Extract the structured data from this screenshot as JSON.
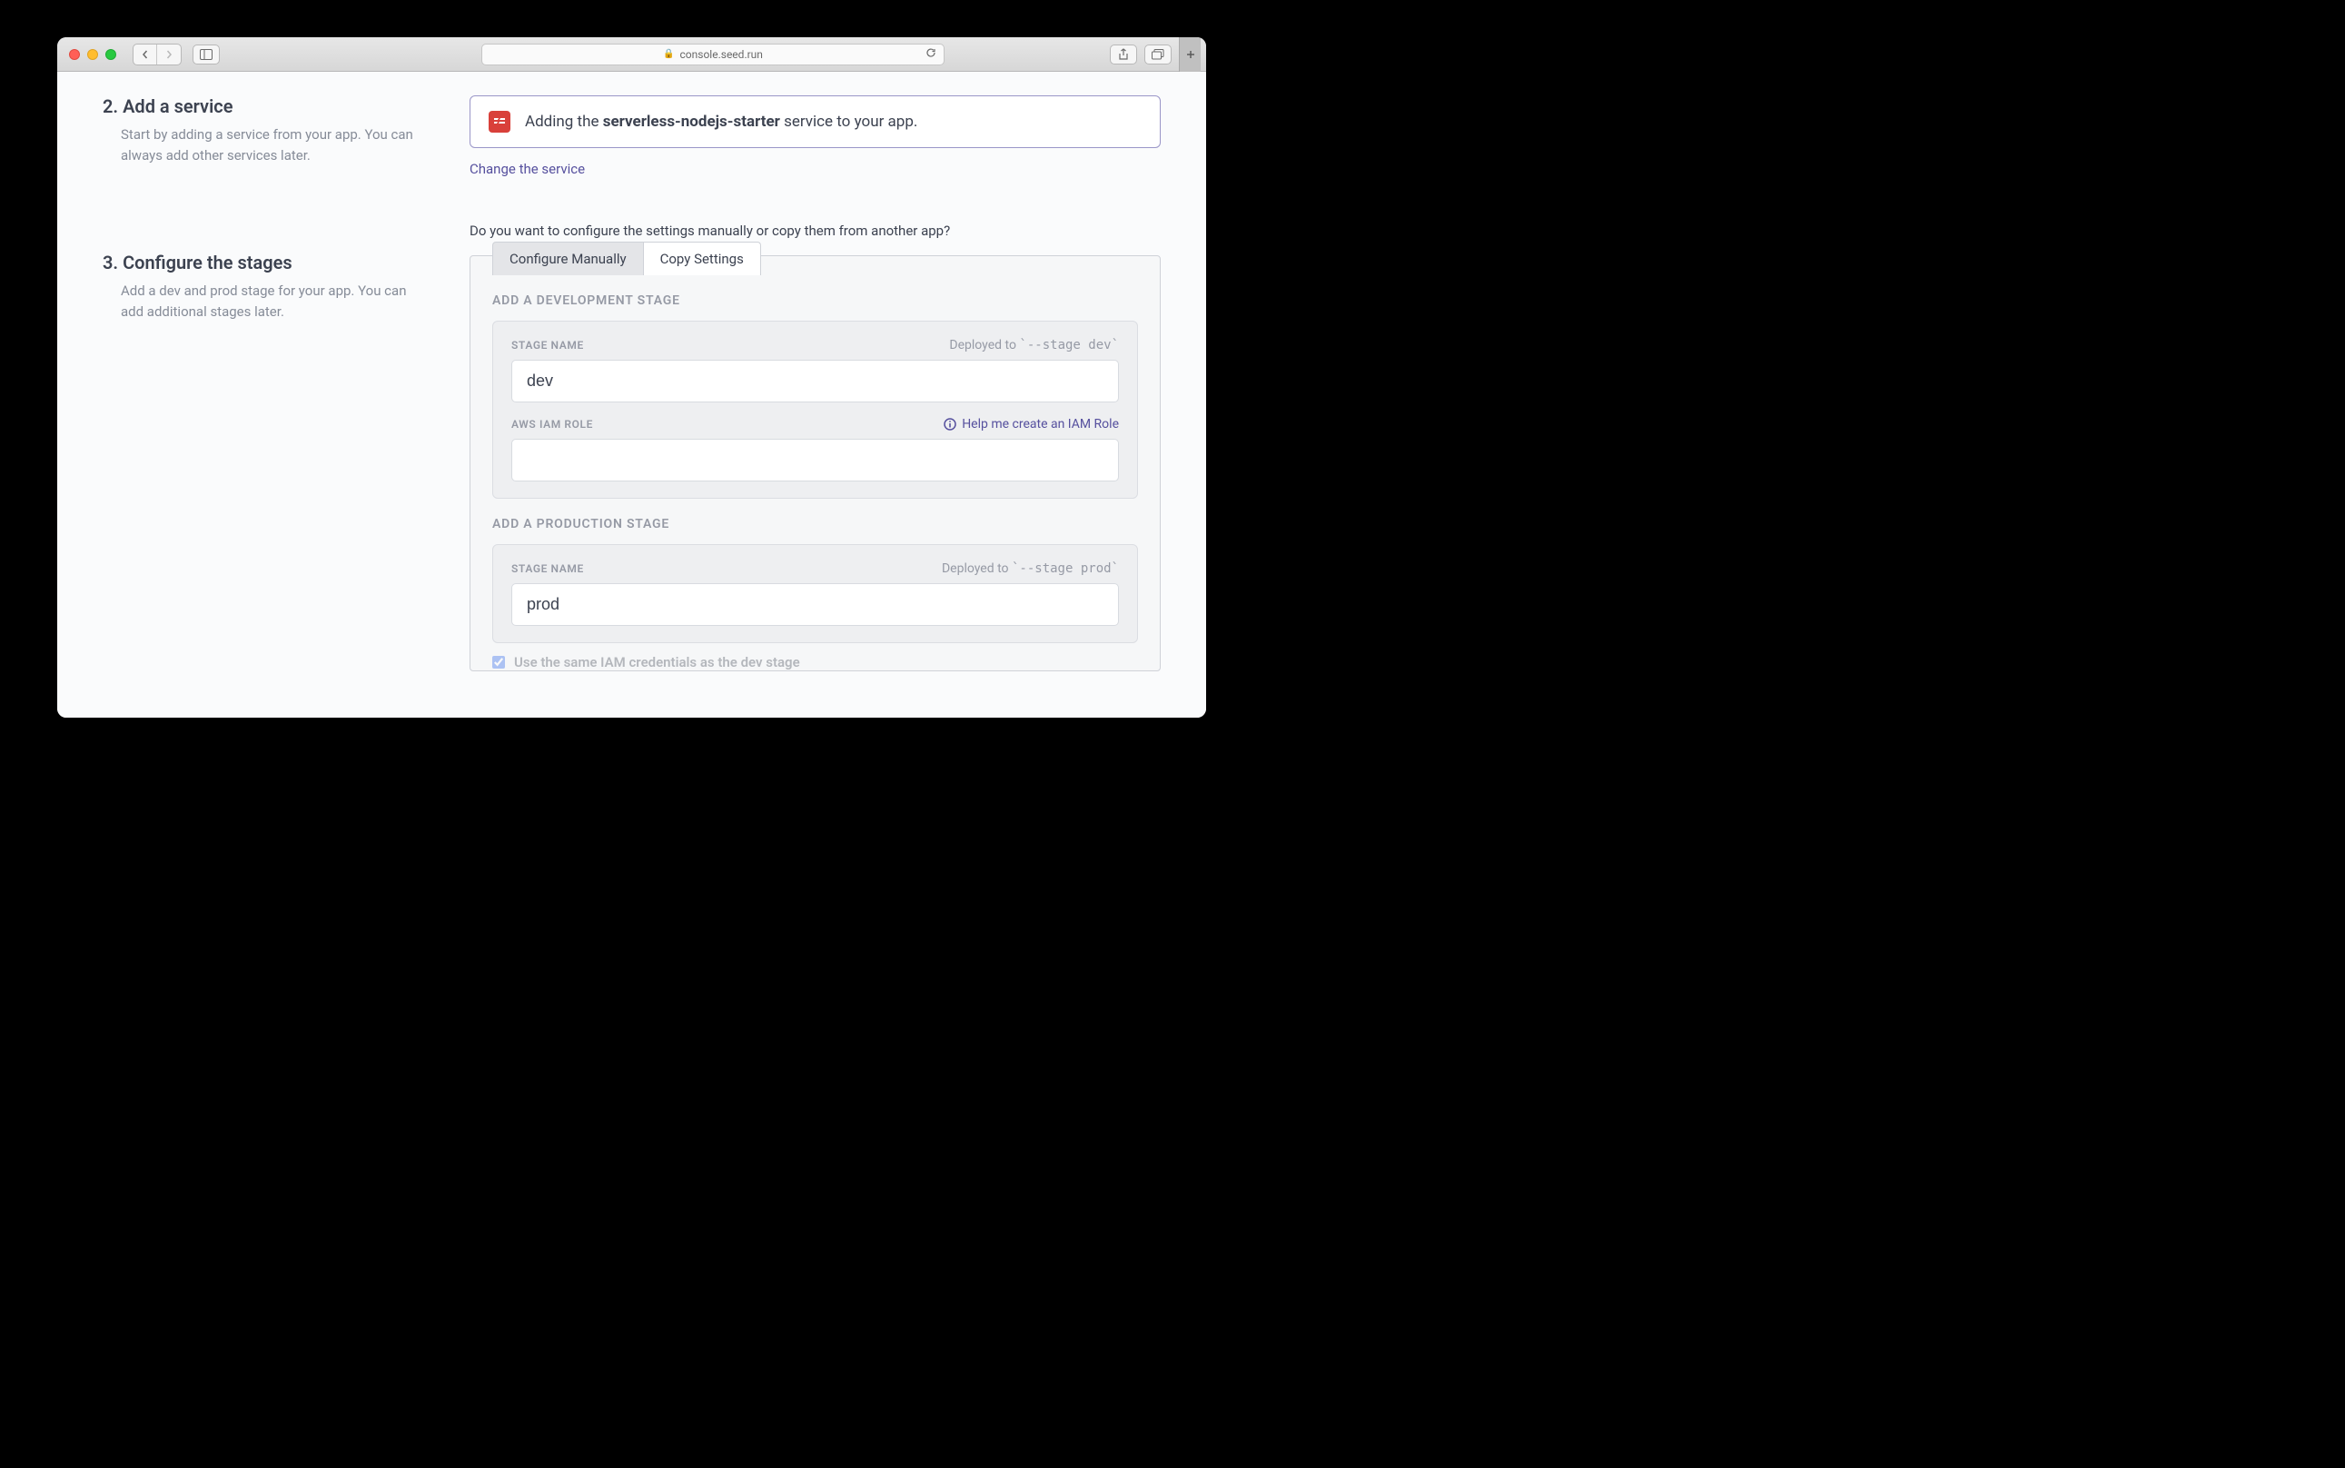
{
  "browser": {
    "address": "console.seed.run"
  },
  "steps": {
    "s2": {
      "title": "2. Add a service",
      "desc": "Start by adding a service from your app. You can always add other services later."
    },
    "s3": {
      "title": "3. Configure the stages",
      "desc": "Add a dev and prod stage for your app. You can add additional stages later."
    }
  },
  "service": {
    "message_pre": "Adding the ",
    "name": "serverless-nodejs-starter",
    "message_post": " service to your app.",
    "change_link": "Change the service"
  },
  "config": {
    "prompt": "Do you want to configure the settings manually or copy them from another app?",
    "tabs": {
      "manual": "Configure Manually",
      "copy": "Copy Settings"
    },
    "dev_section": "ADD A DEVELOPMENT STAGE",
    "prod_section": "ADD A PRODUCTION STAGE",
    "labels": {
      "stage_name": "STAGE NAME",
      "iam_role": "AWS IAM ROLE",
      "deployed_to": "Deployed to ",
      "dev_flag": "`--stage dev`",
      "prod_flag": "`--stage prod`",
      "help_iam": "Help me create an IAM Role",
      "reuse_iam": "Use the same IAM credentials as the dev stage"
    },
    "values": {
      "dev_name": "dev",
      "dev_iam": "",
      "prod_name": "prod"
    }
  }
}
